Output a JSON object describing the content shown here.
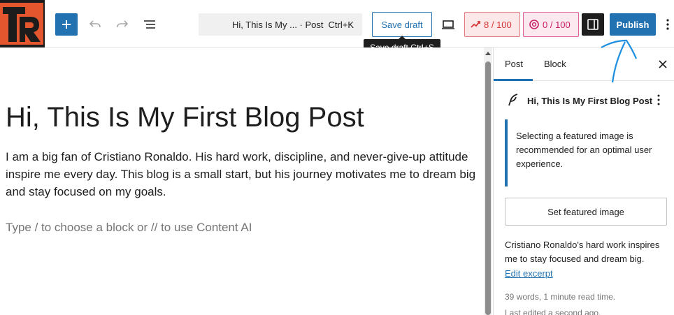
{
  "toolbar": {
    "command_title": "Hi, This Is My ... · Post",
    "command_shortcut": "Ctrl+K",
    "save_draft_label": "Save draft",
    "save_draft_tooltip": "Save draft  Ctrl+S",
    "seo_score": "8 / 100",
    "ai_score": "0 / 100",
    "publish_label": "Publish"
  },
  "editor": {
    "title": "Hi, This Is My First Blog Post",
    "paragraph": "I am a big fan of Cristiano Ronaldo. His hard work, discipline, and never-give-up attitude inspire me every day. This blog is a small start, but his journey motivates me to dream big and stay focused on my goals.",
    "placeholder": "Type / to choose a block or // to use Content AI"
  },
  "sidebar": {
    "tabs": [
      {
        "label": "Post"
      },
      {
        "label": "Block"
      }
    ],
    "document_title": "Hi, This Is My First Blog Post",
    "notice": "Selecting a featured image is recommended for an optimal user experience.",
    "featured_image_button": "Set featured image",
    "excerpt": "Cristiano Ronaldo's hard work inspires me to stay focused and dream big.",
    "edit_excerpt_link": "Edit excerpt",
    "stats": "39 words, 1 minute read time.",
    "last_edited": "Last edited a second ago."
  },
  "colors": {
    "accent": "#2271b1",
    "seo_red": "#d63638",
    "ai_pink": "#c71f66",
    "logo_orange": "#e4572e"
  },
  "icons": {
    "add": "plus-icon",
    "undo": "undo-icon",
    "redo": "redo-icon",
    "list_view": "list-view-icon",
    "preview": "laptop-icon",
    "seo": "seo-rocket-icon",
    "ai": "content-ai-icon",
    "settings": "sidebar-toggle-icon",
    "options": "more-vertical-icon",
    "close": "close-icon",
    "document": "feather-icon"
  }
}
